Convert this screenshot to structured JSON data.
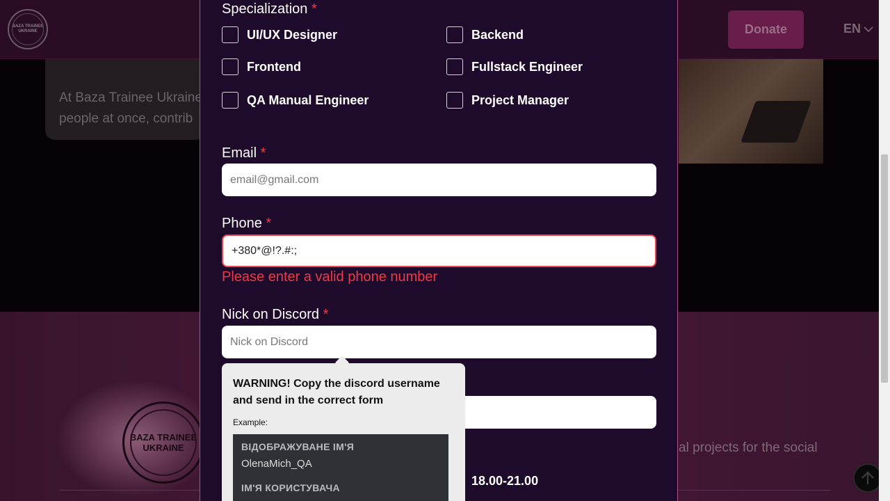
{
  "header": {
    "logo_text": "BAZA TRAINEE UKRAINE",
    "donate_label": "Donate",
    "language": "EN"
  },
  "hero": {
    "card_text": "At Baza Trainee Ukraine ... people at once, contrib..."
  },
  "footer": {
    "logo_text": "BAZA TRAINEE UKRAINE",
    "text": "al projects for the social"
  },
  "form": {
    "specialization_label": "Specialization",
    "required_mark": "*",
    "specializations": [
      "UI/UX Designer",
      "Backend",
      "Frontend",
      "Fullstack Engineer",
      "QA Manual Engineer",
      "Project Manager"
    ],
    "email_label": "Email",
    "email_placeholder": "email@gmail.com",
    "phone_label": "Phone",
    "phone_value": "+380*@!?.#:;",
    "phone_error": "Please enter a valid phone number",
    "discord_label": "Nick on Discord",
    "discord_placeholder": "Nick on Discord",
    "time_value": "18.00-21.00"
  },
  "tooltip": {
    "title": "WARNING! Copy the discord username and send in the correct form",
    "example_label": "Example:",
    "display_name_heading": "ВІДОБРАЖУВАНЕ ІМ'Я",
    "display_name_value": "OlenaMich_QA",
    "username_heading": "ІМ'Я КОРИСТУВАЧА"
  }
}
